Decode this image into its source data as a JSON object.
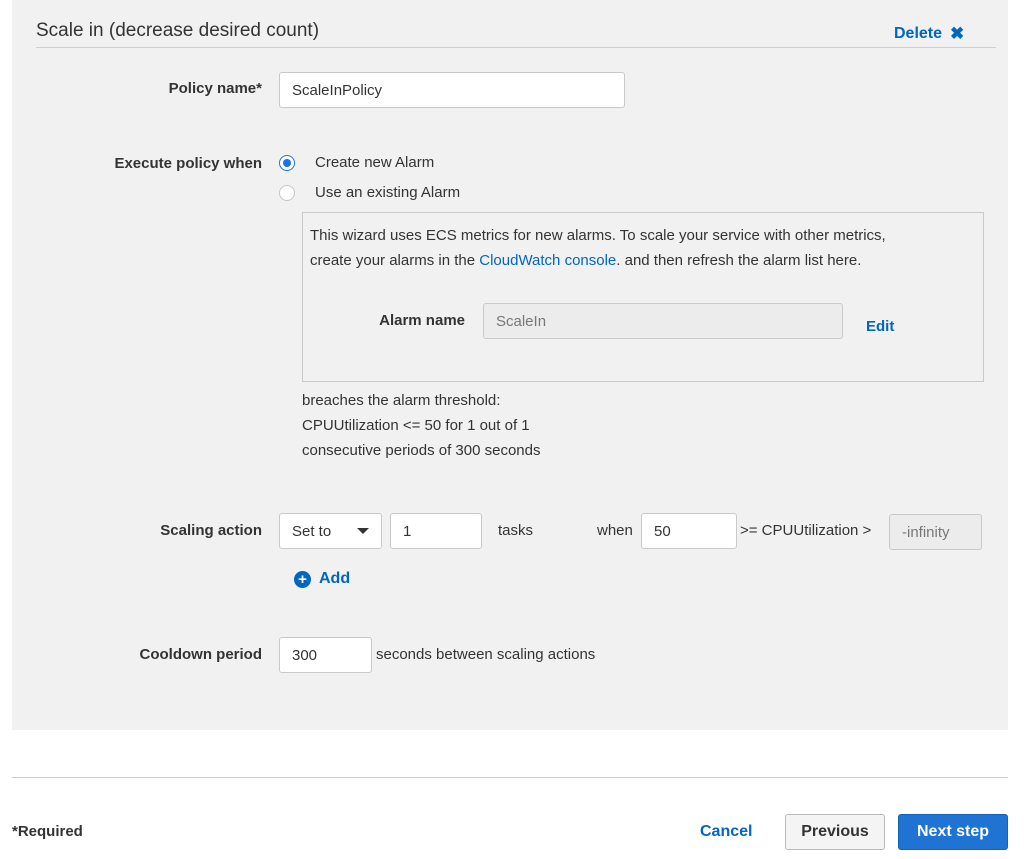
{
  "section": {
    "title": "Scale in (decrease desired count)",
    "delete_label": "Delete",
    "delete_icon": "✖"
  },
  "policy_name": {
    "label": "Policy name*",
    "value": "ScaleInPolicy"
  },
  "execute_policy": {
    "label": "Execute policy when",
    "options": [
      {
        "label": "Create new Alarm",
        "selected": true
      },
      {
        "label": "Use an existing Alarm",
        "selected": false
      }
    ]
  },
  "alarm_box": {
    "text_before_link": "This wizard uses ECS metrics for new alarms. To scale your service with other metrics,",
    "text_line2_prefix": "create your alarms in the ",
    "link": "CloudWatch console",
    "text_line2_suffix": ". and then refresh the alarm list here.",
    "alarm_name_label": "Alarm name",
    "alarm_name_value": "ScaleIn",
    "edit_label": "Edit"
  },
  "threshold": {
    "line1": "breaches the alarm threshold:",
    "line2": "CPUUtilization <= 50 for 1 out of 1",
    "line3": "consecutive periods of 300 seconds"
  },
  "scaling_action": {
    "label": "Scaling action",
    "mode_selected": "Set to",
    "count": "1",
    "tasks_label": "tasks",
    "when_label": "when",
    "threshold_value": "50",
    "metric_text": ">= CPUUtilization >",
    "lower_bound": "-infinity",
    "add_label": "Add"
  },
  "cooldown": {
    "label": "Cooldown period",
    "value": "300",
    "suffix": "seconds between scaling actions"
  },
  "footer": {
    "required_note": "*Required",
    "cancel_label": "Cancel",
    "previous_label": "Previous",
    "next_label": "Next step"
  },
  "colors": {
    "link": "#0066c0",
    "primary_button": "#1f73d2",
    "panel_bg": "#f1f1f1"
  }
}
